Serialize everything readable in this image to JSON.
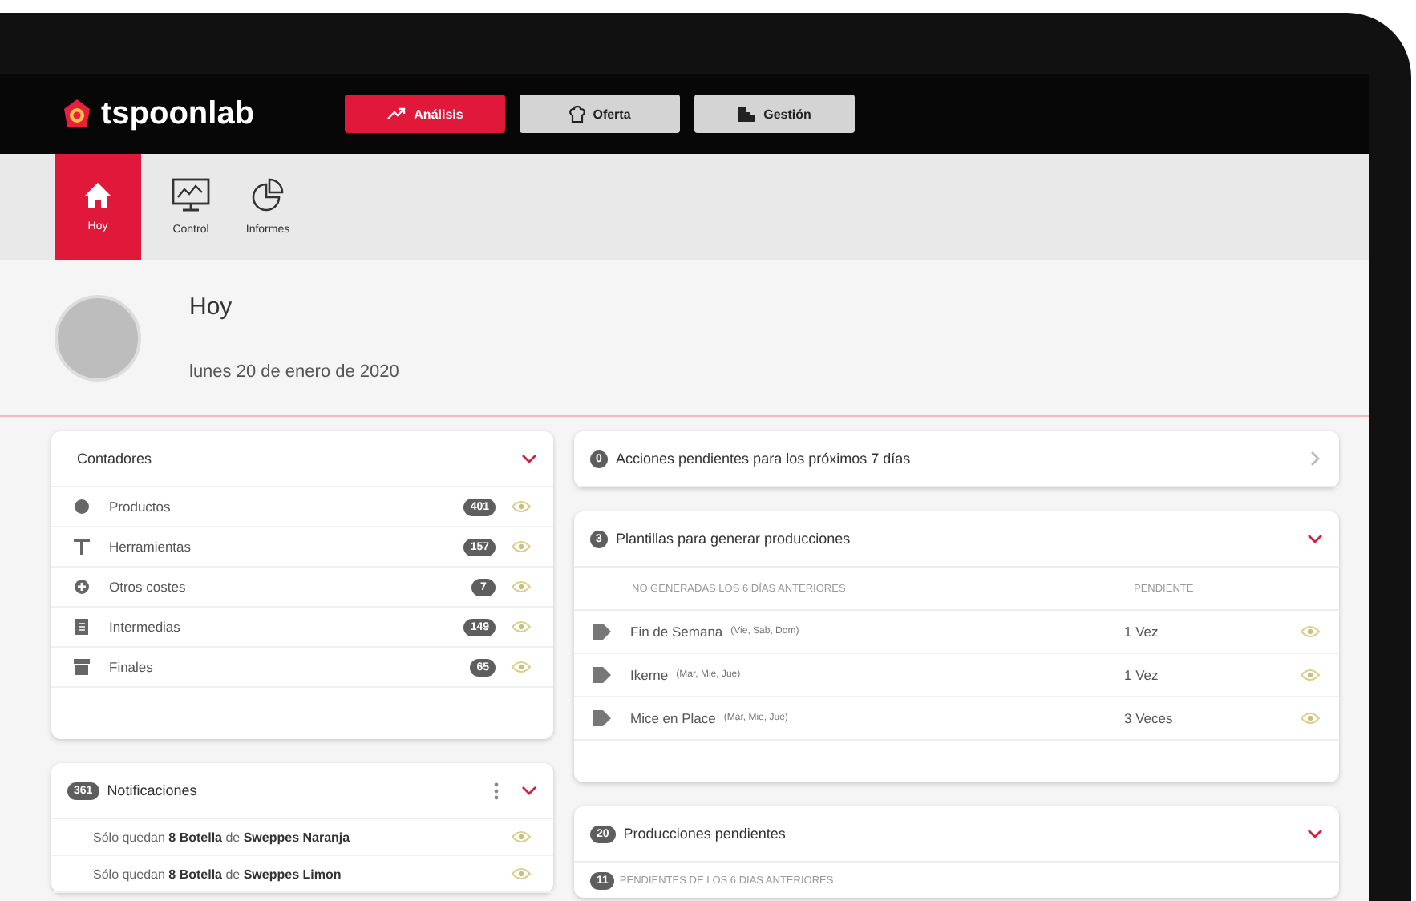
{
  "header": {
    "logo": "tspoonlab",
    "modules": [
      {
        "label": "Análisis",
        "selected": true
      },
      {
        "label": "Oferta",
        "selected": false
      },
      {
        "label": "Gestión",
        "selected": false
      }
    ]
  },
  "subnav": [
    {
      "label": "Hoy",
      "selected": true
    },
    {
      "label": "Control",
      "selected": false
    },
    {
      "label": "Informes",
      "selected": false
    }
  ],
  "page": {
    "title": "Hoy",
    "date": "lunes 20 de enero de 2020"
  },
  "counters": {
    "title": "Contadores",
    "expanded": true,
    "items": [
      {
        "label": "Productos",
        "count": "401"
      },
      {
        "label": "Herramientas",
        "count": "157"
      },
      {
        "label": "Otros costes",
        "count": "7"
      },
      {
        "label": "Intermedias",
        "count": "149"
      },
      {
        "label": "Finales",
        "count": "65"
      }
    ]
  },
  "notifications": {
    "count": "361",
    "title": "Notificaciones",
    "expanded": true,
    "items": [
      "Sólo quedan **8 Botella** de **Sweppes Naranja**",
      "Sólo quedan **8 Botella** de **Sweppes Limon**"
    ]
  },
  "actions": {
    "count": "0",
    "title": "Acciones pendientes para los próximos 7 días",
    "expanded": false
  },
  "templates": {
    "count": "3",
    "title": "Plantillas para generar producciones",
    "expanded": true,
    "columns": [
      "NO GENERADAS LOS 6 DÍAS ANTERIORES",
      "PENDIENTE"
    ],
    "rows": [
      {
        "name": "Fin de Semana",
        "days": "(Vie, Sab, Dom)",
        "pending": "1 Vez"
      },
      {
        "name": "Ikerne",
        "days": "(Mar, Mie, Jue)",
        "pending": "1 Vez"
      },
      {
        "name": "Mice en Place",
        "days": "(Mar, Mie, Jue)",
        "pending": "3 Veces"
      }
    ]
  },
  "productions": {
    "count": "20",
    "title": "Producciones pendientes",
    "expanded": true,
    "sub_count": "11",
    "sub_title": "PENDIENTES DE LOS 6 DIAS ANTERIORES"
  }
}
